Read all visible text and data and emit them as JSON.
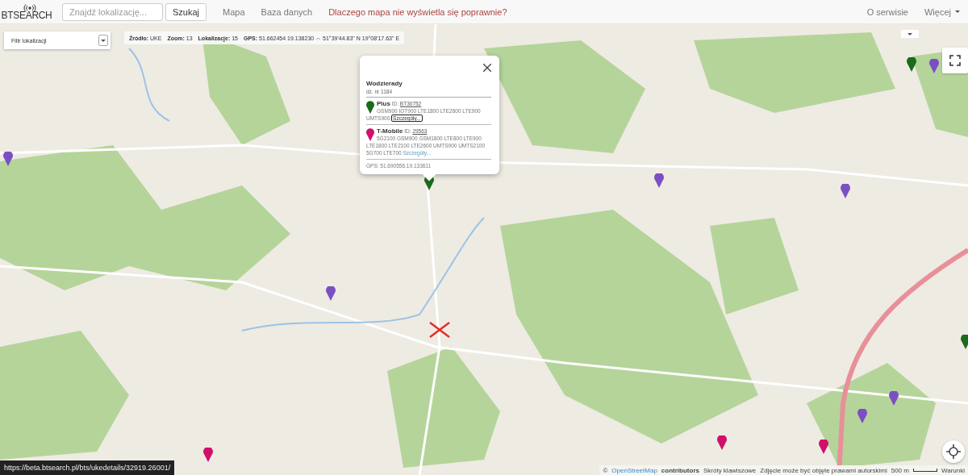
{
  "navbar": {
    "logo": "BTSEARCH",
    "search": {
      "placeholder": "Znajdź lokalizację..."
    },
    "search_button": "Szukaj",
    "links": [
      {
        "label": "Mapa",
        "kind": "plain"
      },
      {
        "label": "Baza danych",
        "kind": "plain"
      },
      {
        "label": "Dlaczego mapa nie wyświetla się poprawnie?",
        "kind": "alert"
      }
    ],
    "right_links": [
      {
        "label": "O serwisie",
        "dropdown": false
      },
      {
        "label": "Więcej",
        "dropdown": true
      }
    ]
  },
  "filter": {
    "label": "Filtr lokalizacji"
  },
  "info_bar": [
    {
      "label": "Źródło:",
      "value": "UKE"
    },
    {
      "label": "Zoom:",
      "value": "13"
    },
    {
      "label": "Lokalizacje:",
      "value": "15"
    },
    {
      "label": "GPS:",
      "value": "51.662454 19.138230 ⇔ 51°39'44.83\" N 19°08'17.63\" E"
    }
  ],
  "popup": {
    "title": "Wodzierady",
    "subtitle": "dz. nr 1184",
    "operators": [
      {
        "name": "Plus",
        "id_label": "ID:",
        "id": "BT30752",
        "bands": "GSM900 IOT900 LTE1800 LTE2600 LTE900 UMTS900",
        "details": "Szczegóły...",
        "focused": true,
        "color": "#1a6b1a"
      },
      {
        "name": "T-Mobile",
        "id_label": "ID:",
        "id": "29563",
        "bands": "5G2100 GSM900 GSM1800 LTE800 LTE900 LTE1800 LTE2100 LTE2600 UMTS900 UMTS2100 5G700 LTE700",
        "details": "Szczegóły...",
        "focused": false,
        "color": "#d0106a"
      }
    ],
    "gps": "GPS: 51.690556,19.133611"
  },
  "markers": [
    {
      "color": "#7b4fc4"
    },
    {
      "color": "#1a6b1a"
    },
    {
      "color": "#7b4fc4"
    },
    {
      "color": "#7b4fc4"
    },
    {
      "color": "#7b4fc4"
    },
    {
      "color": "#1a6b1a"
    },
    {
      "color": "#7b4fc4"
    },
    {
      "color": "#7b4fc4"
    },
    {
      "color": "#7b4fc4"
    },
    {
      "color": "#d0106a"
    },
    {
      "color": "#d0106a"
    },
    {
      "color": "#d0106a"
    },
    {
      "color": "#1a6b1a"
    }
  ],
  "attribution": {
    "copyright": "©",
    "osm": "OpenStreetMap",
    "contributors": "contributors",
    "shortcuts": "Skróty klawiszowe",
    "imagery": "Zdjęcie może być objęte prawami autorskimi",
    "scale": "500 m",
    "terms": "Warunki"
  },
  "status_url": "https://beta.btsearch.pl/bts/ukedetails/32919.26001/"
}
